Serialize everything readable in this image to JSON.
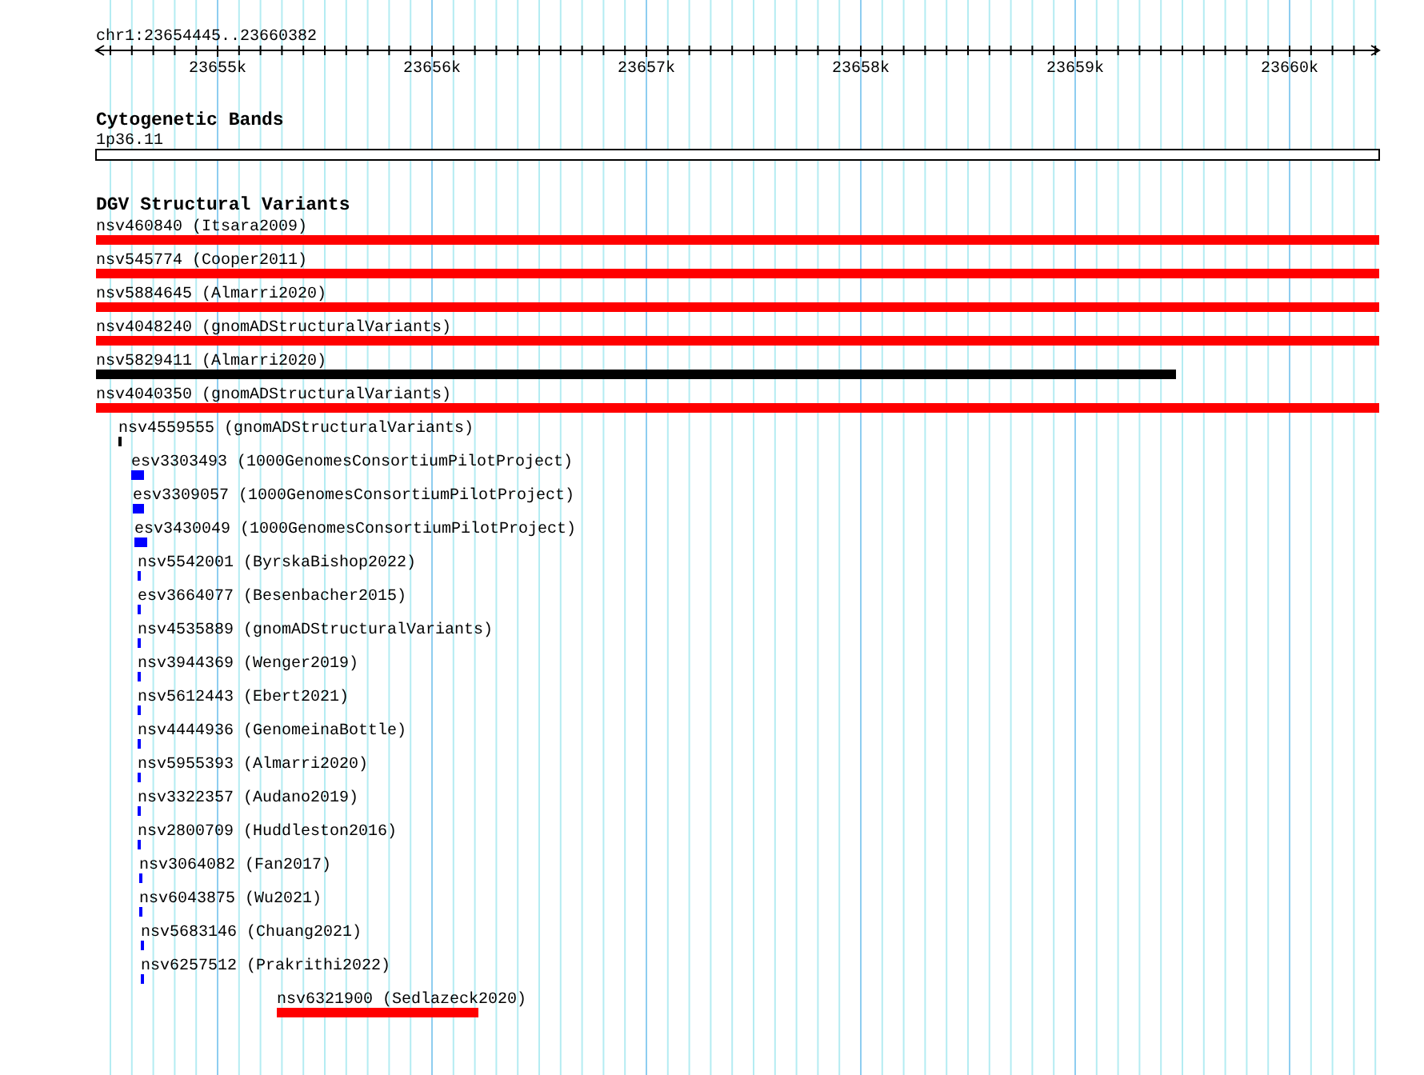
{
  "ruler": {
    "range": "chr1:23654445..23660382",
    "ticks": [
      "23655k",
      "23656k",
      "23657k",
      "23658k",
      "23659k",
      "23660k"
    ]
  },
  "tracks": [
    {
      "title": "Cytogenetic Bands",
      "features": [
        {
          "label": "1p36.11"
        }
      ]
    },
    {
      "title": "DGV Structural Variants",
      "features": [
        {
          "label": "nsv460840 (Itsara2009)",
          "color": "#ff0000"
        },
        {
          "label": "nsv545774 (Cooper2011)",
          "color": "#ff0000"
        },
        {
          "label": "nsv5884645 (Almarri2020)",
          "color": "#ff0000"
        },
        {
          "label": "nsv4048240 (gnomADStructuralVariants)",
          "color": "#ff0000"
        },
        {
          "label": "nsv5829411 (Almarri2020)",
          "color": "#000000"
        },
        {
          "label": "nsv4040350 (gnomADStructuralVariants)",
          "color": "#ff0000"
        },
        {
          "label": "nsv4559555 (gnomADStructuralVariants)",
          "color": "#000000"
        },
        {
          "label": "esv3303493 (1000GenomesConsortiumPilotProject)",
          "color": "#0000ff"
        },
        {
          "label": "esv3309057 (1000GenomesConsortiumPilotProject)",
          "color": "#0000ff"
        },
        {
          "label": "esv3430049 (1000GenomesConsortiumPilotProject)",
          "color": "#0000ff"
        },
        {
          "label": "nsv5542001 (ByrskaBishop2022)",
          "color": "#0000ff"
        },
        {
          "label": "esv3664077 (Besenbacher2015)",
          "color": "#0000ff"
        },
        {
          "label": "nsv4535889 (gnomADStructuralVariants)",
          "color": "#0000ff"
        },
        {
          "label": "nsv3944369 (Wenger2019)",
          "color": "#0000ff"
        },
        {
          "label": "nsv5612443 (Ebert2021)",
          "color": "#0000ff"
        },
        {
          "label": "nsv4444936 (GenomeinaBottle)",
          "color": "#0000ff"
        },
        {
          "label": "nsv5955393 (Almarri2020)",
          "color": "#0000ff"
        },
        {
          "label": "nsv3322357 (Audano2019)",
          "color": "#0000ff"
        },
        {
          "label": "nsv2800709 (Huddleston2016)",
          "color": "#0000ff"
        },
        {
          "label": "nsv3064082 (Fan2017)",
          "color": "#0000ff"
        },
        {
          "label": "nsv6043875 (Wu2021)",
          "color": "#0000ff"
        },
        {
          "label": "nsv5683146 (Chuang2021)",
          "color": "#0000ff"
        },
        {
          "label": "nsv6257512 (Prakrithi2022)",
          "color": "#0000ff"
        },
        {
          "label": "nsv6321900 (Sedlazeck2020)",
          "color": "#ff0000"
        }
      ]
    }
  ]
}
